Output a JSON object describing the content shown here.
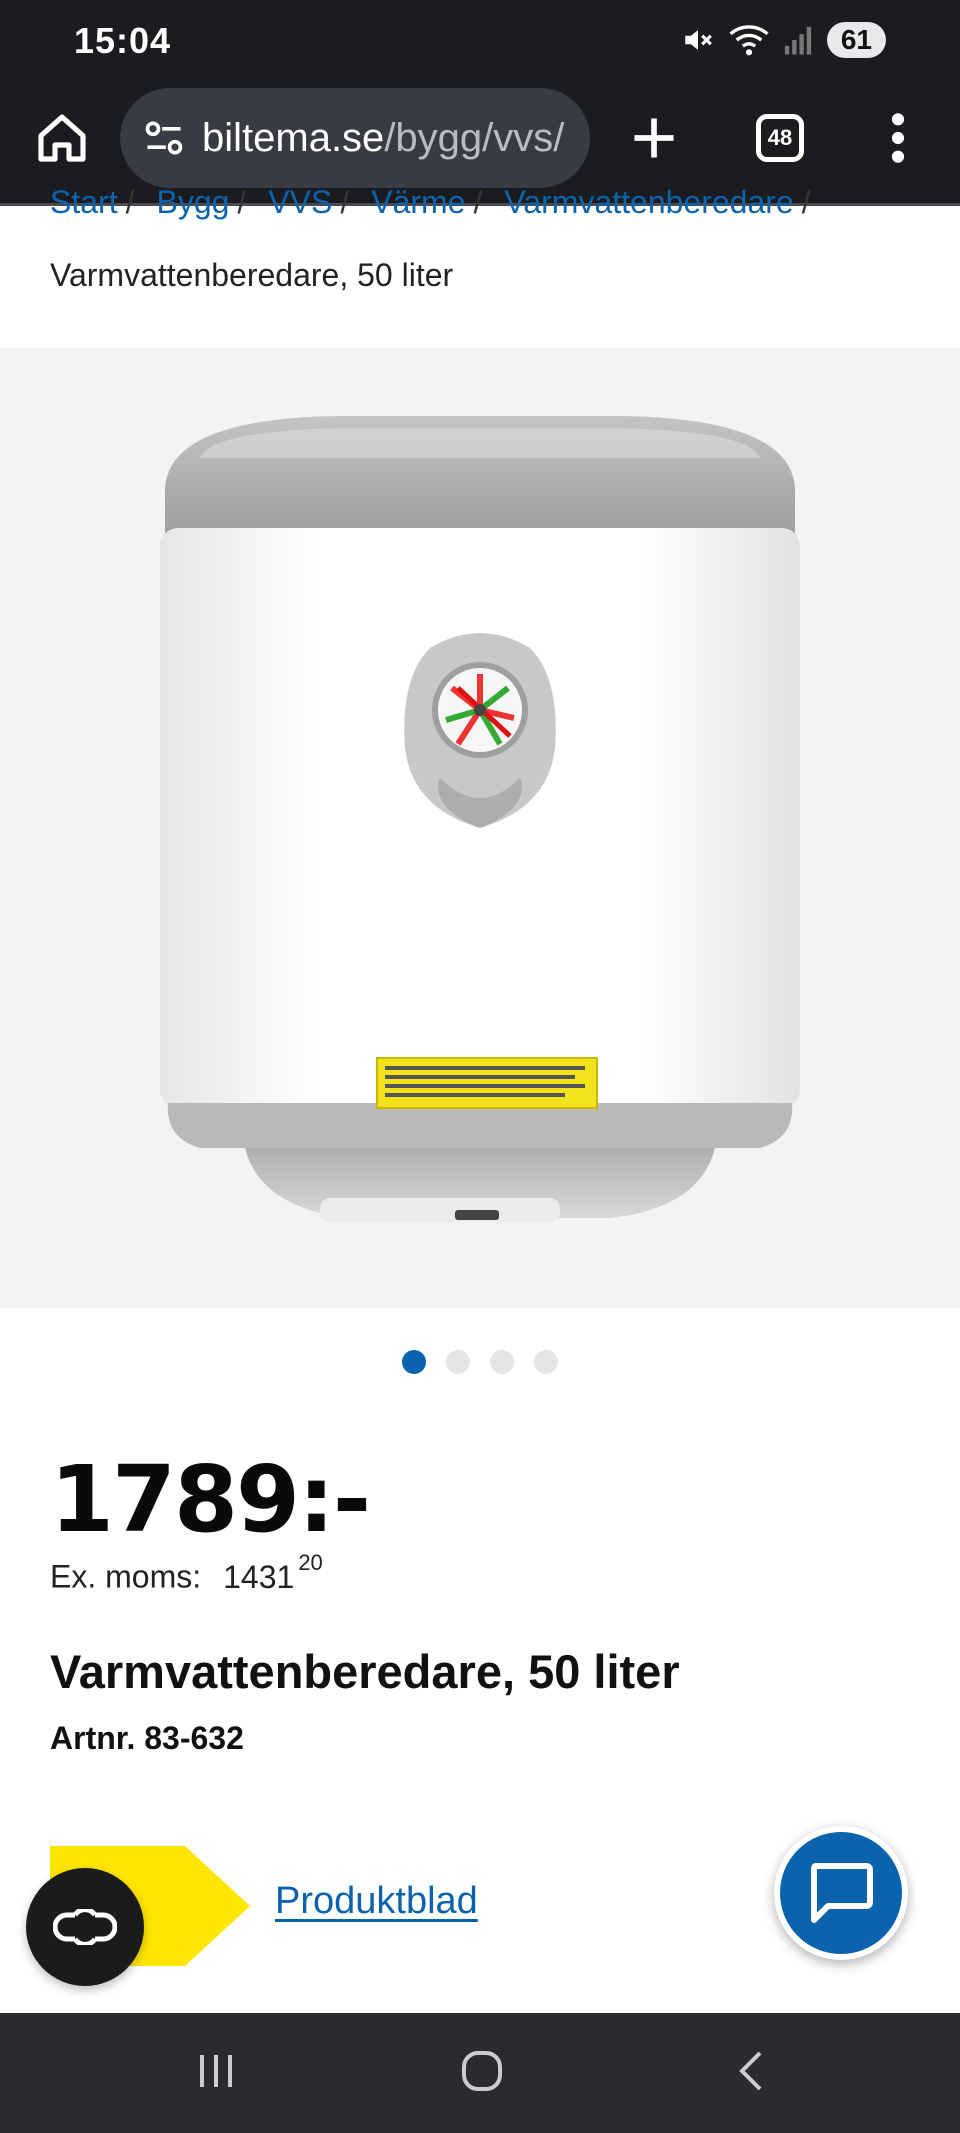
{
  "status_bar": {
    "time": "15:04",
    "battery": "61",
    "icons": [
      "mute-icon",
      "wifi-icon",
      "signal-icon"
    ]
  },
  "browser": {
    "url_domain": "biltema.se",
    "url_path": "/bygg/vvs/",
    "tab_count": "48",
    "icons": [
      "home-icon",
      "site-settings-icon",
      "new-tab-icon",
      "more-menu-icon"
    ]
  },
  "breadcrumb": {
    "items": [
      "Start",
      "Bygg",
      "VVS",
      "Värme",
      "Varmvattenberedare"
    ],
    "separator": "/",
    "current": "Varmvattenberedare, 50 liter"
  },
  "gallery": {
    "total": 4,
    "active_index": 0
  },
  "product": {
    "price": "1789:-",
    "ex_moms_label": "Ex. moms:",
    "ex_moms_value": "1431",
    "ex_moms_decimals": "20",
    "title": "Varmvattenberedare, 50 liter",
    "artnr": "Artnr. 83-632",
    "produktblad_link": "Produktblad"
  },
  "colors": {
    "brand_blue": "#0b63ad",
    "brand_yellow": "#ffe600",
    "toolbar_bg": "#1b1c20"
  }
}
